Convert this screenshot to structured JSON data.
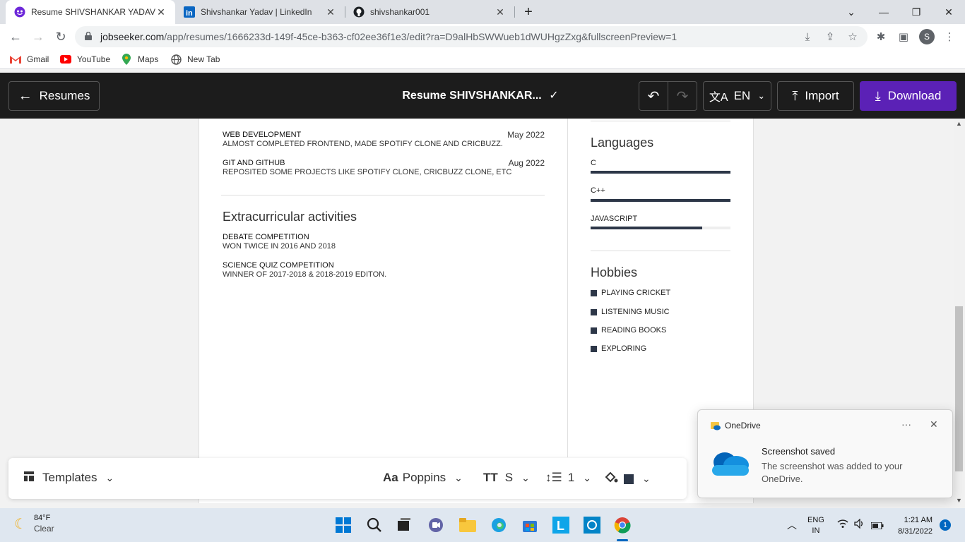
{
  "tabs": [
    {
      "label": "Resume SHIVSHANKAR YADAV Y",
      "icon": "jobseeker-icon",
      "active": true
    },
    {
      "label": "Shivshankar Yadav | LinkedIn",
      "icon": "linkedin-icon",
      "active": false
    },
    {
      "label": "shivshankar001",
      "icon": "github-icon",
      "active": false
    }
  ],
  "address": {
    "host": "jobseeker.com",
    "path": "/app/resumes/1666233d-149f-45ce-b363-cf02ee36f1e3/edit?ra=D9alHbSWWueb1dWUHgzZxg&fullscreenPreview=1"
  },
  "profile_initial": "S",
  "bookmarks": [
    {
      "label": "Gmail",
      "icon": "gmail-icon"
    },
    {
      "label": "YouTube",
      "icon": "youtube-icon"
    },
    {
      "label": "Maps",
      "icon": "maps-icon"
    },
    {
      "label": "New Tab",
      "icon": "globe-icon"
    }
  ],
  "header": {
    "back_label": "Resumes",
    "doc_title": "Resume SHIVSHANKAR...",
    "lang": "EN",
    "import_label": "Import",
    "download_label": "Download",
    "download_color": "#5b21b6"
  },
  "resume": {
    "projects": [
      {
        "title": "WEB DEVELOPMENT",
        "date": "May 2022",
        "desc": "ALMOST COMPLETED FRONTEND, MADE SPOTIFY CLONE AND CRICBUZZ."
      },
      {
        "title": "GIT AND GITHUB",
        "date": "Aug 2022",
        "desc": "REPOSITED SOME PROJECTS LIKE SPOTIFY CLONE, CRICBUZZ CLONE, ETC"
      }
    ],
    "extracurricular_heading": "Extracurricular activities",
    "extracurricular": [
      {
        "title": "DEBATE COMPETITION",
        "desc": "WON TWICE IN 2016 AND 2018"
      },
      {
        "title": "SCIENCE QUIZ COMPETITION",
        "desc": "WINNER OF 2017-2018 & 2018-2019 EDITON."
      }
    ],
    "languages_heading": "Languages",
    "languages": [
      {
        "name": "C",
        "level": 1.0
      },
      {
        "name": "C++",
        "level": 1.0
      },
      {
        "name": "JAVASCRIPT",
        "level": 0.8
      }
    ],
    "hobbies_heading": "Hobbies",
    "hobbies": [
      "PLAYING CRICKET",
      "LISTENING MUSIC",
      "READING BOOKS",
      "EXPLORING"
    ]
  },
  "bottombar": {
    "templates_label": "Templates",
    "font_label": "Poppins",
    "font_prefix": "Aa",
    "size_label": "S",
    "spacing_label": "1"
  },
  "toast": {
    "app": "OneDrive",
    "title": "Screenshot saved",
    "body": "The screenshot was added to your OneDrive.",
    "more": "···"
  },
  "taskbar": {
    "temp": "84°F",
    "weather": "Clear",
    "lang_top": "ENG",
    "lang_bottom": "IN",
    "time": "1:21 AM",
    "date": "8/31/2022",
    "notif_count": "1"
  }
}
